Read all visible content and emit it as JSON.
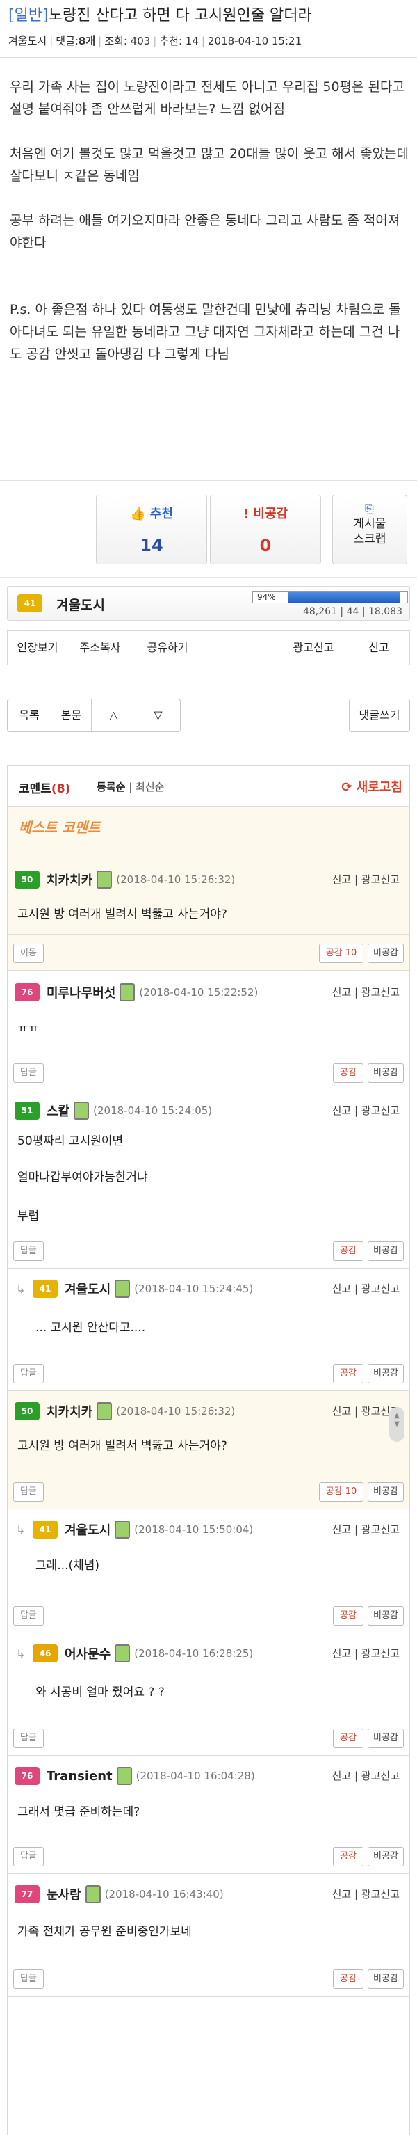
{
  "post": {
    "category": "[일반]",
    "title": "노량진 산다고 하면 다 고시원인줄 알더라",
    "author": "겨울도시",
    "comments_label": "댓글:",
    "comments_count": "8개",
    "views": "조회: 403",
    "recommend_meta": "추천: 14",
    "datetime": "2018-04-10 15:21",
    "body": [
      "우리 가족 사는 집이 노량진이라고 전세도 아니고 우리집 50평은 된다고 설명 붙여줘야 좀 안쓰럽게 바라보는? 느낌 없어짐",
      "처음엔 여기 볼것도 많고 먹을것고 많고 20대들 많이 웃고 해서 좋았는데 살다보니 ㅈ같은 동네임",
      "공부 하려는 애들 여기오지마라 안좋은 동네다 그리고 사람도 좀 적어져야한다",
      "P.s. 아 좋은점 하나 있다 여동생도 말한건데 민낯에 츄리닝 차림으로 돌아다녀도 되는 유일한 동네라고 그냥 대자연 그자체라고 하는데 그건 나도 공감 안씻고 돌아댕김 다 그렇게 다님"
    ]
  },
  "votes": {
    "recommend_label": "추천",
    "recommend_count": "14",
    "oppose_label": "비공감",
    "oppose_count": "0",
    "board_label_1": "게시물",
    "board_label_2": "스크랩"
  },
  "author_bar": {
    "level": "41",
    "name": "겨울도시",
    "progress_pct": 94,
    "progress_label": "94%",
    "stats": "48,261 | 44 | 18,083"
  },
  "actions": [
    "인장보기",
    "주소복사",
    "공유하기",
    "",
    "광고신고",
    "신고"
  ],
  "nav": {
    "list": "목록",
    "body": "본문",
    "up": "△",
    "down": "▽",
    "reply": "댓글쓰기"
  },
  "comments_header": {
    "title": "코멘트",
    "count": "(8)",
    "sort_reg": "등록순",
    "sort_sep": "|",
    "sort_new": "최신순",
    "refresh": "새로고침"
  },
  "best_label": "베스트 코멘트",
  "comments": [
    {
      "level": "50",
      "name": "치카치카",
      "date": "(2018-04-10 15:26:32)",
      "report": "신고 | 광고신고",
      "text": "고시원 방 여러개 빌려서 벽뚫고 사는거야?",
      "left_btn": "이동",
      "good": "공감 10",
      "bad": "비공감"
    },
    {
      "level": "76",
      "name": "미루나무버섯",
      "date": "(2018-04-10 15:22:52)",
      "report": "신고 | 광고신고",
      "text": "ㅠㅠ",
      "left_btn": "답글",
      "good": "공감",
      "bad": "비공감"
    },
    {
      "level": "51",
      "name": "스칼",
      "date": "(2018-04-10 15:24:05)",
      "report": "신고 | 광고신고",
      "text1": "50평짜리 고시원이면",
      "text2": "얼마나갑부여야가능한거냐",
      "text3": "부럽",
      "left_btn": "답글",
      "good": "공감",
      "bad": "비공감"
    },
    {
      "level": "41",
      "name": "겨울도시",
      "date": "(2018-04-10 15:24:45)",
      "report": "신고 | 광고신고",
      "text": "... 고시원 안산다고....",
      "left_btn": "답글",
      "good": "공감",
      "bad": "비공감"
    },
    {
      "level": "50",
      "name": "치카치카",
      "date": "(2018-04-10 15:26:32)",
      "report": "신고 | 광고신고",
      "text": "고시원 방 여러개 빌려서 벽뚫고 사는거야?",
      "left_btn": "답글",
      "good": "공감 10",
      "bad": "비공감"
    },
    {
      "level": "41",
      "name": "겨울도시",
      "date": "(2018-04-10 15:50:04)",
      "report": "신고 | 광고신고",
      "text": "그래...(체념)",
      "left_btn": "답글",
      "good": "공감",
      "bad": "비공감"
    },
    {
      "level": "46",
      "name": "어사문수",
      "date": "(2018-04-10 16:28:25)",
      "report": "신고 | 광고신고",
      "text": "와 시공비 얼마 줬어요 ? ?",
      "left_btn": "답글",
      "good": "공감",
      "bad": "비공감"
    },
    {
      "level": "76",
      "name": "Transient",
      "date": "(2018-04-10 16:04:28)",
      "report": "신고 | 광고신고",
      "text": "그래서 몇급 준비하는데?",
      "left_btn": "답글",
      "good": "공감",
      "bad": "비공감"
    },
    {
      "level": "77",
      "name": "눈사랑",
      "date": "(2018-04-10 16:43:40)",
      "report": "신고 | 광고신고",
      "text": "가족 전체가 공무원 준비중인가보네",
      "left_btn": "답글",
      "good": "공감",
      "bad": "비공감"
    }
  ],
  "colors": {
    "category": "#3a6fd0",
    "accent_red": "#d0302a",
    "best_bg": "#fdf9ec",
    "progress": "#1e5fc4"
  }
}
